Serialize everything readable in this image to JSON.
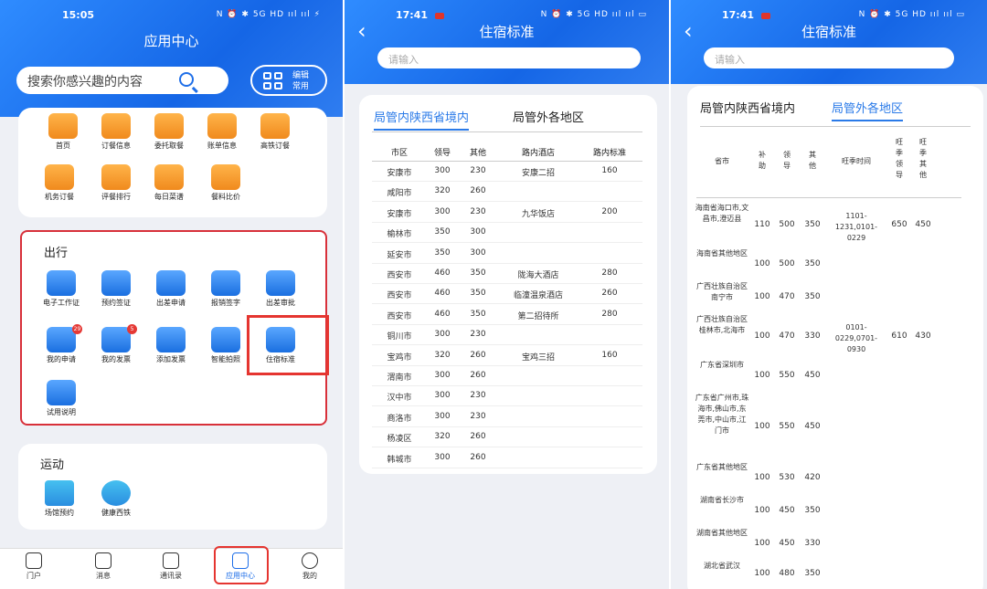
{
  "p1": {
    "time": "15:05",
    "status_icons": "N ⏰ ✱ 5G HD ııl ııl ⚡",
    "title": "应用中心",
    "search_placeholder": "搜索你感兴趣的内容",
    "edit_line1": "编辑",
    "edit_line2": "常用",
    "top_items": [
      "首页",
      "订餐信息",
      "委托取餐",
      "账单信息",
      "高铁订餐",
      "机务订餐",
      "评餐排行",
      "每日菜谱",
      "餐料比价"
    ],
    "section_travel": "出行",
    "travel_items": [
      "电子工作证",
      "预约签证",
      "出差申请",
      "报销签字",
      "出差审批",
      "我的申请",
      "我的发票",
      "添加发票",
      "智能拍照",
      "住宿标准",
      "试用说明"
    ],
    "badge_my_apply": "29",
    "badge_my_invoice": "5",
    "section_sport": "运动",
    "sport_items": [
      "场馆预约",
      "健康西铁"
    ],
    "tabs": [
      "门户",
      "消息",
      "通讯录",
      "应用中心",
      "我的"
    ]
  },
  "p2": {
    "time": "17:41",
    "status_icons": "N ⏰ ✱ 5G HD ııl ııl ▭",
    "title": "住宿标准",
    "back": "‹",
    "search_placeholder": "请输入",
    "tab_a": "局管内陕西省境内",
    "tab_b": "局管外各地区",
    "headers": [
      "市区",
      "领导",
      "其他",
      "路内酒店",
      "路内标准"
    ],
    "rows": [
      [
        "安康市",
        "300",
        "230",
        "安康二招",
        "160"
      ],
      [
        "咸阳市",
        "320",
        "260",
        "",
        ""
      ],
      [
        "安康市",
        "300",
        "230",
        "九华饭店",
        "200"
      ],
      [
        "榆林市",
        "350",
        "300",
        "",
        ""
      ],
      [
        "延安市",
        "350",
        "300",
        "",
        ""
      ],
      [
        "西安市",
        "460",
        "350",
        "陇海大酒店",
        "280"
      ],
      [
        "西安市",
        "460",
        "350",
        "临潼温泉酒店",
        "260"
      ],
      [
        "西安市",
        "460",
        "350",
        "第二招待所",
        "280"
      ],
      [
        "铜川市",
        "300",
        "230",
        "",
        ""
      ],
      [
        "宝鸡市",
        "320",
        "260",
        "宝鸡三招",
        "160"
      ],
      [
        "渭南市",
        "300",
        "260",
        "",
        ""
      ],
      [
        "汉中市",
        "300",
        "230",
        "",
        ""
      ],
      [
        "商洛市",
        "300",
        "230",
        "",
        ""
      ],
      [
        "杨凌区",
        "320",
        "260",
        "",
        ""
      ],
      [
        "韩城市",
        "300",
        "260",
        "",
        ""
      ]
    ]
  },
  "p3": {
    "time": "17:41",
    "status_icons": "N ⏰ ✱ 5G HD ııl ııl ▭",
    "title": "住宿标准",
    "back": "‹",
    "search_placeholder": "请输入",
    "tab_a": "局管内陕西省境内",
    "tab_b": "局管外各地区",
    "headers": [
      "省市",
      "补助",
      "领导",
      "其他",
      "旺季时间",
      "旺季领导",
      "旺季其他"
    ],
    "rows": [
      [
        "海南省海口市,文昌市,澄迈县",
        "110",
        "500",
        "350",
        "1101-1231,0101-0229",
        "650",
        "450"
      ],
      [
        "海南省其他地区",
        "100",
        "500",
        "350",
        "",
        "",
        ""
      ],
      [
        "广西壮族自治区南宁市",
        "100",
        "470",
        "350",
        "",
        "",
        ""
      ],
      [
        "广西壮族自治区桂林市,北海市",
        "100",
        "470",
        "330",
        "0101-0229,0701-0930",
        "610",
        "430"
      ],
      [
        "广东省深圳市",
        "100",
        "550",
        "450",
        "",
        "",
        ""
      ],
      [
        "广东省广州市,珠海市,佛山市,东莞市,中山市,江门市",
        "100",
        "550",
        "450",
        "",
        "",
        ""
      ],
      [
        "广东省其他地区",
        "100",
        "530",
        "420",
        "",
        "",
        ""
      ],
      [
        "湖南省长沙市",
        "100",
        "450",
        "350",
        "",
        "",
        ""
      ],
      [
        "湖南省其他地区",
        "100",
        "450",
        "330",
        "",
        "",
        ""
      ],
      [
        "湖北省武汉",
        "100",
        "480",
        "350",
        "",
        "",
        ""
      ]
    ]
  }
}
